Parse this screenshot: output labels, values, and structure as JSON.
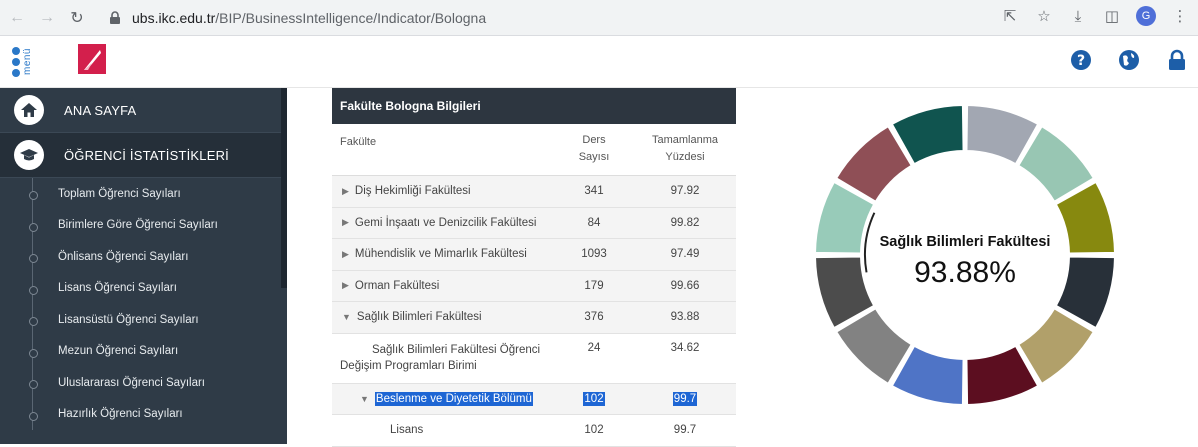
{
  "browser": {
    "url_host": "ubs.ikc.edu.tr",
    "url_path": "/BIP/BusinessIntelligence/Indicator/Bologna",
    "profile_initial": "G"
  },
  "header": {
    "menu_label": "menü",
    "icons": [
      "help-icon",
      "globe-icon",
      "lock-icon"
    ]
  },
  "sidebar": {
    "main_items": [
      {
        "label": "ANA SAYFA",
        "icon": "home-icon"
      },
      {
        "label": "ÖĞRENCİ İSTATİSTİKLERİ",
        "icon": "graduation-cap-icon"
      }
    ],
    "sub_items": [
      "Toplam Öğrenci Sayıları",
      "Birimlere Göre Öğrenci Sayıları",
      "Önlisans Öğrenci Sayıları",
      "Lisans Öğrenci Sayıları",
      "Lisansüstü Öğrenci Sayıları",
      "Mezun Öğrenci Sayıları",
      "Uluslararası Öğrenci Sayıları",
      "Hazırlık Öğrenci Sayıları"
    ]
  },
  "table": {
    "title": "Fakülte Bologna Bilgileri",
    "col_faculty": "Fakülte",
    "col_ders_1": "Ders",
    "col_ders_2": "Sayısı",
    "col_tam_1": "Tamamlanma",
    "col_tam_2": "Yüzdesi",
    "rows": [
      {
        "name": "Diş Hekimliği Fakültesi",
        "ders": "341",
        "yuzde": "97.92"
      },
      {
        "name": "Gemi İnşaatı ve Denizcilik Fakültesi",
        "ders": "84",
        "yuzde": "99.82"
      },
      {
        "name": "Mühendislik ve Mimarlık Fakültesi",
        "ders": "1093",
        "yuzde": "97.49"
      },
      {
        "name": "Orman Fakültesi",
        "ders": "179",
        "yuzde": "99.66"
      },
      {
        "name": "Sağlık Bilimleri Fakültesi",
        "ders": "376",
        "yuzde": "93.88"
      }
    ],
    "sub_unit": {
      "line1": "Sağlık Bilimleri Fakültesi Öğrenci",
      "line2": "Değişim Programları Birimi",
      "ders": "24",
      "yuzde": "34.62"
    },
    "dept": {
      "name": "Beslenme ve Diyetetik Bölümü",
      "ders": "102",
      "yuzde": "99.7"
    },
    "program": {
      "name": "Lisans",
      "ders": "102",
      "yuzde": "99.7"
    }
  },
  "donut": {
    "title": "Sağlık Bilimleri Fakültesi",
    "value": "93.88%",
    "segment_colors": [
      "#a2a7b2",
      "#98c6b3",
      "#87890f",
      "#283039",
      "#b1a06a",
      "#5c0e20",
      "#4f74c6",
      "#828282",
      "#4c4c4c",
      "#98cbb9",
      "#8f4f56",
      "#10544f"
    ]
  }
}
